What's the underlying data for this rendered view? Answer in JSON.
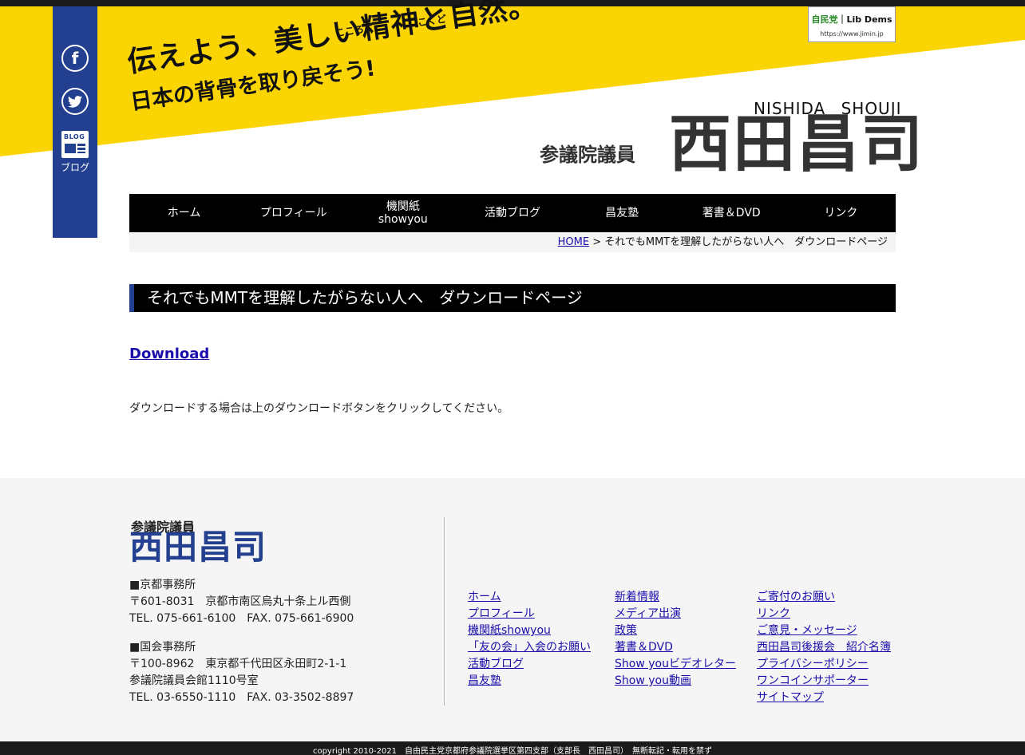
{
  "header": {
    "slogan_line1": "伝えよう、美しい精神と自然。",
    "slogan_line2": "日本の背骨を取り戻そう!",
    "ruby_kokoro": "こころ",
    "ruby_kokudo": "こくど",
    "party_badge_text_green": "自民党",
    "party_badge_text": "Lib Dems",
    "party_badge_url": "https://www.jimin.jp",
    "name_romaji": "NISHIDA SHOUJI",
    "role": "参議院議員",
    "name": "西田昌司"
  },
  "sidebar": {
    "facebook_glyph": "f",
    "twitter_glyph": "t",
    "blog_icon_text": "BLOG",
    "blog_label": "ブログ"
  },
  "nav": {
    "items": [
      {
        "label": "ホーム"
      },
      {
        "label": "プロフィール"
      },
      {
        "label": "機関紙\nshowyou"
      },
      {
        "label": "活動ブログ"
      },
      {
        "label": "昌友塾"
      },
      {
        "label": "著書＆DVD"
      },
      {
        "label": "リンク"
      }
    ]
  },
  "breadcrumb": {
    "home": "HOME",
    "separator": " > ",
    "current": "それでもMMTを理解したがらない人へ　ダウンロードページ"
  },
  "main": {
    "page_title": "それでもMMTを理解したがらない人へ　ダウンロードページ",
    "download_link": "Download",
    "note": "ダウンロードする場合は上のダウンロードボタンをクリックしてください。"
  },
  "footer": {
    "role": "参議院議員",
    "name": "西田昌司",
    "kyoto_office": {
      "title": "■京都事務所",
      "address": "〒601-8031　京都市南区烏丸十条上ル西側",
      "tel": "TEL. 075-661-6100　FAX. 075-661-6900"
    },
    "diet_office": {
      "title": "■国会事務所",
      "address": "〒100-8962　東京都千代田区永田町2-1-1",
      "room": "参議院議員会館1110号室",
      "tel": "TEL. 03-6550-1110　FAX. 03-3502-8897"
    },
    "links_col1": [
      "ホーム",
      "プロフィール",
      "機関紙showyou",
      "「友の会」入会のお願い",
      "活動ブログ",
      "昌友塾"
    ],
    "links_col2": [
      "新着情報",
      "メディア出演",
      "政策",
      "著書＆DVD",
      "Show youビデオレター",
      "Show you動画"
    ],
    "links_col3": [
      "ご寄付のお願い",
      "リンク",
      "ご意見・メッセージ",
      "西田昌司後援会　紹介名簿",
      "プライバシーポリシー",
      "ワンコインサポーター",
      "サイトマップ"
    ],
    "copyright": "copyright 2010-2021　自由民主党京都府参議院選挙区第四支部（支部長　西田昌司）　無断転記・転用を禁ず"
  },
  "colors": {
    "accent_yellow": "#fbd403",
    "brand_blue": "#233f8f",
    "nav_black": "#000000"
  }
}
